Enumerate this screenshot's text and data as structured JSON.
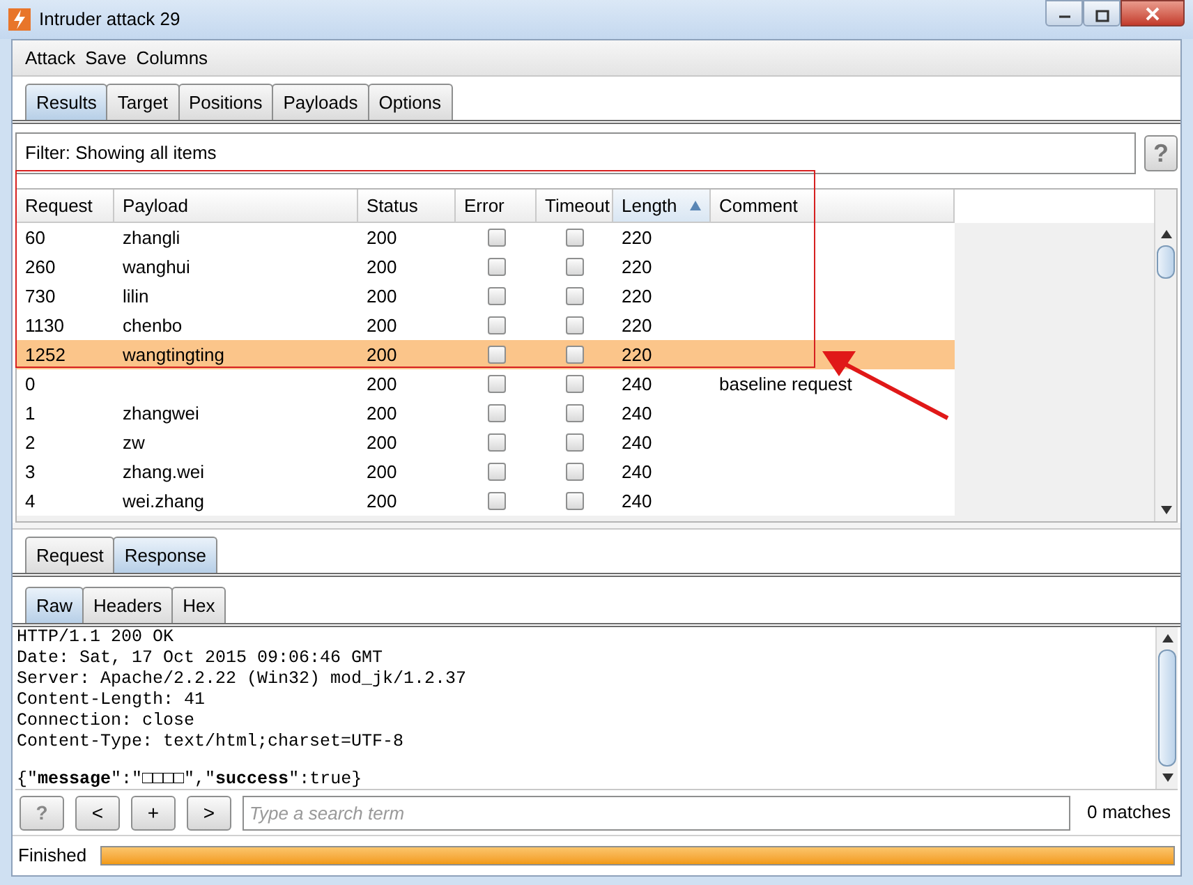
{
  "window": {
    "title": "Intruder attack 29"
  },
  "menu": [
    "Attack",
    "Save",
    "Columns"
  ],
  "tabs": [
    {
      "label": "Results",
      "selected": true
    },
    {
      "label": "Target",
      "selected": false
    },
    {
      "label": "Positions",
      "selected": false
    },
    {
      "label": "Payloads",
      "selected": false
    },
    {
      "label": "Options",
      "selected": false
    }
  ],
  "filter": {
    "text": "Filter: Showing all items",
    "help": "?"
  },
  "table": {
    "columns": [
      {
        "label": "Request",
        "sorted": false
      },
      {
        "label": "Payload",
        "sorted": false
      },
      {
        "label": "Status",
        "sorted": false
      },
      {
        "label": "Error",
        "sorted": false
      },
      {
        "label": "Timeout",
        "sorted": false
      },
      {
        "label": "Length",
        "sorted": true
      },
      {
        "label": "Comment",
        "sorted": false
      }
    ],
    "rows": [
      {
        "request": "60",
        "payload": "zhangli",
        "status": "200",
        "error": false,
        "timeout": false,
        "length": "220",
        "selected": false
      },
      {
        "request": "260",
        "payload": "wanghui",
        "status": "200",
        "error": false,
        "timeout": false,
        "length": "220",
        "selected": false
      },
      {
        "request": "730",
        "payload": "lilin",
        "status": "200",
        "error": false,
        "timeout": false,
        "length": "220",
        "selected": false
      },
      {
        "request": "1130",
        "payload": "chenbo",
        "status": "200",
        "error": false,
        "timeout": false,
        "length": "220",
        "selected": false
      },
      {
        "request": "1252",
        "payload": "wangtingting",
        "status": "200",
        "error": false,
        "timeout": false,
        "length": "220",
        "selected": true
      },
      {
        "request": "0",
        "status": "200",
        "error": false,
        "timeout": false,
        "length": "240",
        "comment": "baseline request",
        "selected": false
      },
      {
        "request": "1",
        "payload": "zhangwei",
        "status": "200",
        "error": false,
        "timeout": false,
        "length": "240",
        "selected": false
      },
      {
        "request": "2",
        "payload": "zw",
        "status": "200",
        "error": false,
        "timeout": false,
        "length": "240",
        "selected": false
      },
      {
        "request": "3",
        "payload": "zhang.wei",
        "status": "200",
        "error": false,
        "timeout": false,
        "length": "240",
        "selected": false
      },
      {
        "request": "4",
        "payload": "wei.zhang",
        "status": "200",
        "error": false,
        "timeout": false,
        "length": "240",
        "selected": false
      }
    ]
  },
  "message_tabs": [
    {
      "label": "Request",
      "selected": false
    },
    {
      "label": "Response",
      "selected": true
    }
  ],
  "view_tabs": [
    {
      "label": "Raw",
      "selected": true
    },
    {
      "label": "Headers",
      "selected": false
    },
    {
      "label": "Hex",
      "selected": false
    }
  ],
  "response": {
    "headers": [
      "HTTP/1.1 200 OK",
      "Date: Sat, 17 Oct 2015 09:06:46 GMT",
      "Server: Apache/2.2.22 (Win32) mod_jk/1.2.37",
      "Content-Length: 41",
      "Connection: close",
      "Content-Type: text/html;charset=UTF-8"
    ],
    "body": "{\"**message**\":\"□□□□\",\"**success**\":true}"
  },
  "search": {
    "buttons": [
      "?",
      "<",
      "+",
      ">"
    ],
    "placeholder": "Type a search term",
    "matches": "0 matches"
  },
  "status": {
    "text": "Finished",
    "level": 1.0
  }
}
